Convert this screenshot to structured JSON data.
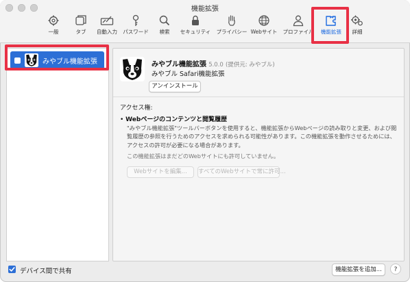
{
  "window": {
    "title": "機能拡張"
  },
  "toolbar": {
    "items": [
      {
        "label": "一般",
        "icon": "gear-icon"
      },
      {
        "label": "タブ",
        "icon": "tabs-icon"
      },
      {
        "label": "自動入力",
        "icon": "autofill-icon"
      },
      {
        "label": "パスワード",
        "icon": "key-icon"
      },
      {
        "label": "検索",
        "icon": "search-icon"
      },
      {
        "label": "セキュリティ",
        "icon": "lock-icon"
      },
      {
        "label": "プライバシー",
        "icon": "hand-icon"
      },
      {
        "label": "Webサイト",
        "icon": "globe-icon"
      },
      {
        "label": "プロファイル",
        "icon": "person-icon"
      },
      {
        "label": "機能拡張",
        "icon": "puzzle-icon",
        "active": true
      },
      {
        "label": "詳細",
        "icon": "advanced-gears-icon"
      }
    ],
    "accent": "#1c6ae0",
    "highlight_color": "#e83045"
  },
  "sidebar": {
    "items": [
      {
        "label": "みやブル機能拡張",
        "enabled": false,
        "selected": true
      }
    ]
  },
  "detail": {
    "name": "みやブル機能拡張",
    "version": "5.0.0",
    "provider": "(提供元: みやブル)",
    "subtitle": "みやブル Safari機能拡張",
    "uninstall_label": "アンインストール",
    "access_header": "アクセス権:",
    "permission_title": "Webページのコンテンツと閲覧履歴",
    "permission_desc": "\"みやブル機能拡張\"ツールバーボタンを使用すると、機能拡張からWebページの読み取りと変更、および閲覧履歴の参照を行うためのアクセスを求められる可能性があります。この機能拡張を動作させるためには、アクセスの許可が必要になる場合があります。",
    "note": "この機能拡張はまだどのWebサイトにも許可していません。",
    "edit_sites_label": "Webサイトを編集...",
    "allow_all_label": "すべてのWebサイトで常に許可..."
  },
  "footer": {
    "share_label": "デバイス間で共有",
    "share_checked": true,
    "add_label": "機能拡張を追加...",
    "help_label": "?"
  }
}
